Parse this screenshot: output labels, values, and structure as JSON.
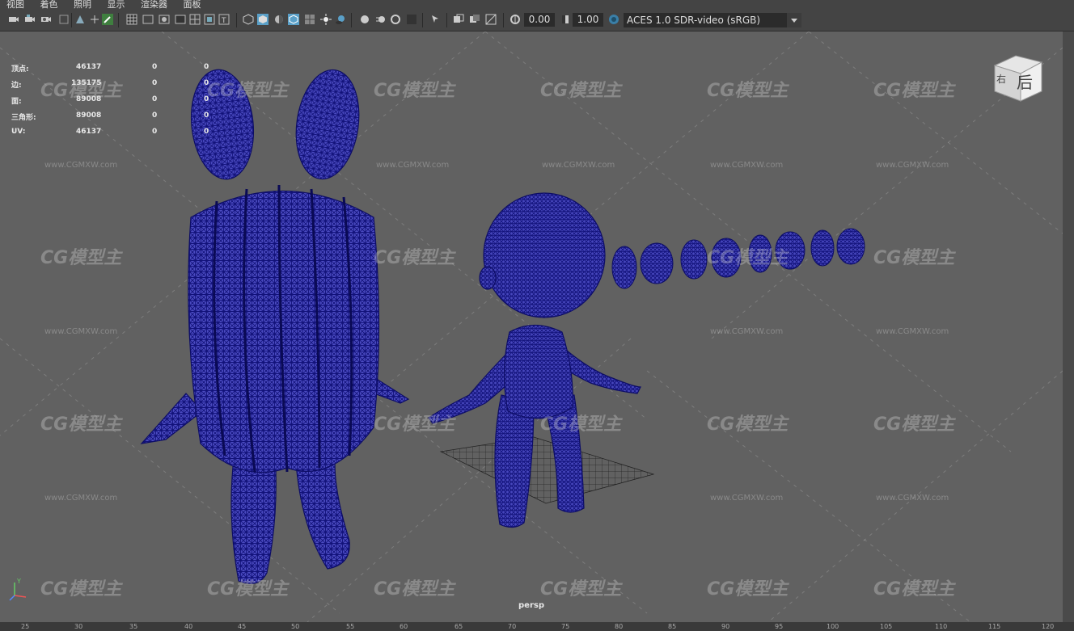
{
  "menu": [
    "视图",
    "着色",
    "照明",
    "显示",
    "渲染器",
    "面板"
  ],
  "toolbar": {
    "exposure": "0.00",
    "gamma": "1.00",
    "colorspace": "ACES 1.0 SDR-video (sRGB)"
  },
  "hud": {
    "rows": [
      {
        "label": "顶点:",
        "v1": "46137",
        "v2": "0",
        "v3": "0"
      },
      {
        "label": "边:",
        "v1": "135175",
        "v2": "0",
        "v3": "0"
      },
      {
        "label": "面:",
        "v1": "89008",
        "v2": "0",
        "v3": "0"
      },
      {
        "label": "三角形:",
        "v1": "89008",
        "v2": "0",
        "v3": "0"
      },
      {
        "label": "UV:",
        "v1": "46137",
        "v2": "0",
        "v3": "0"
      }
    ]
  },
  "viewcube": {
    "label": "后",
    "side_label": "右"
  },
  "camera_label": "persp",
  "watermark": {
    "logo": "CG模型主",
    "url": "www.CGMXW.com"
  },
  "ruler": [
    "25",
    "30",
    "35",
    "40",
    "45",
    "50",
    "55",
    "60",
    "65",
    "70",
    "75",
    "80",
    "85",
    "90",
    "95",
    "100",
    "105",
    "110",
    "115",
    "120"
  ],
  "colors": {
    "wireframe": "#1a1a90",
    "background": "#616161"
  }
}
